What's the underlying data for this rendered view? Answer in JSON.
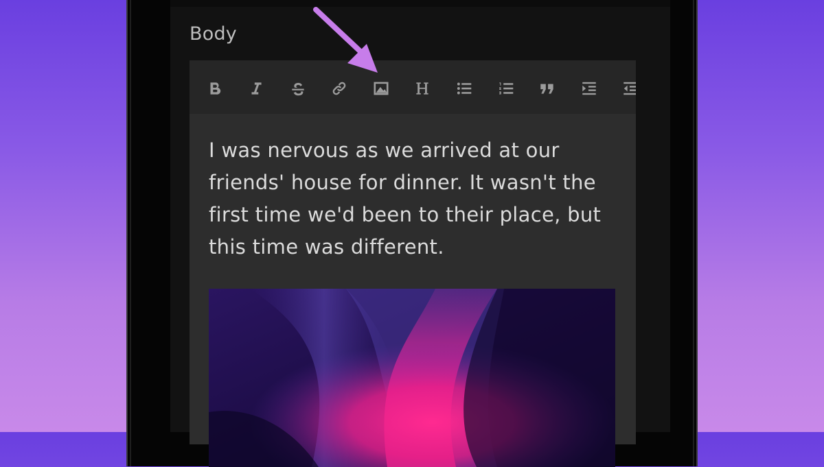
{
  "form": {
    "body_label": "Body"
  },
  "toolbar": {
    "buttons": [
      {
        "name": "bold",
        "icon": "bold-icon",
        "glyph": "B"
      },
      {
        "name": "italic",
        "icon": "italic-icon",
        "glyph": "I"
      },
      {
        "name": "strikethrough",
        "icon": "strikethrough-icon",
        "glyph": "S"
      },
      {
        "name": "link",
        "icon": "link-icon"
      },
      {
        "name": "image",
        "icon": "image-icon"
      },
      {
        "name": "heading",
        "icon": "heading-icon",
        "glyph": "H"
      },
      {
        "name": "bulleted-list",
        "icon": "bulleted-list-icon"
      },
      {
        "name": "numbered-list",
        "icon": "numbered-list-icon"
      },
      {
        "name": "blockquote",
        "icon": "quote-icon"
      },
      {
        "name": "indent",
        "icon": "indent-icon"
      },
      {
        "name": "outdent",
        "icon": "outdent-icon"
      }
    ]
  },
  "editor": {
    "paragraph_lines": [
      "I was nervous as we arrived at our",
      "friends' house for dinner. It wasn't the",
      "first time we'd been to their place, but",
      "this time was different."
    ],
    "embedded_image": {
      "description_colors": [
        "#1b0c3d",
        "#ff1f8e",
        "#5b3fa8"
      ]
    }
  },
  "annotation": {
    "arrow_color": "#c77dea",
    "points_to": "image-icon"
  },
  "colors": {
    "background_top": "#6a3fe0",
    "background_bottom": "#c889e9",
    "screen": "#121212",
    "editor_bg": "#2d2d2d",
    "toolbar_bg": "#262626",
    "icon_color": "#9c9c9c",
    "text_color": "#dcdcdc"
  }
}
